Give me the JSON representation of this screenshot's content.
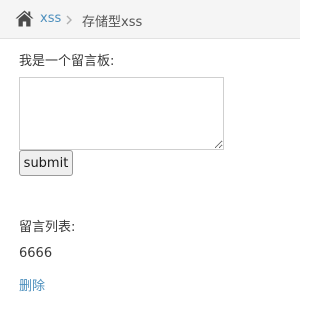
{
  "breadcrumb": {
    "home_icon": "home-icon",
    "link_label": "xss",
    "separator_icon": "chevron-right-icon",
    "current_label": "存储型xss"
  },
  "form": {
    "title": "我是一个留言板:",
    "message_value": "",
    "submit_label": "submit"
  },
  "list": {
    "title": "留言列表:",
    "items": [
      {
        "content": "6666",
        "delete_label": "删除"
      }
    ]
  },
  "colors": {
    "link": "#4c8fbd",
    "breadcrumb_bg": "#f5f5f5",
    "text": "#393939"
  }
}
